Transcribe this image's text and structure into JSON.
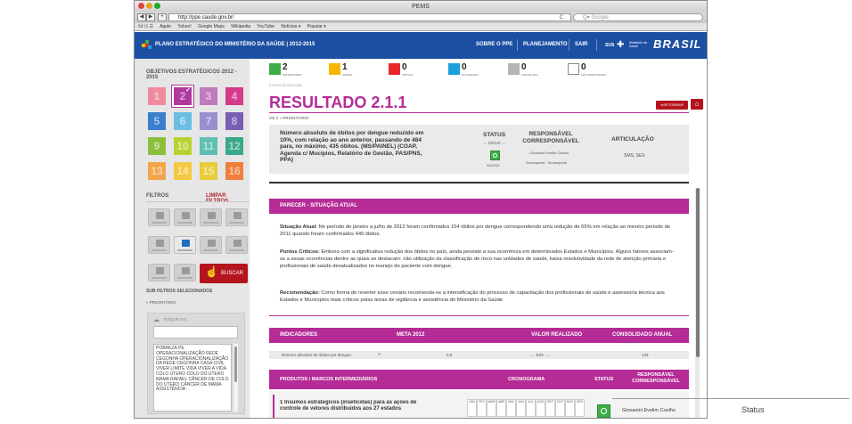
{
  "window": {
    "title": "PEMS"
  },
  "toolbar": {
    "back": "◀",
    "forward": "▶",
    "add": "+",
    "url": "http://ppe.saude.gov.br/",
    "reload": "C",
    "search_placeholder": "Q▾ Google"
  },
  "bookmarks": [
    "Apple",
    "Yahoo!",
    "Google Maps",
    "Wikipedia",
    "YouTube",
    "Notícias ▾",
    "Popular ▾"
  ],
  "header": {
    "title": "PLANO ESTRATÉGICO DO MINISTÉRIO DA SAÚDE | 2012-2015",
    "nav": [
      "SOBRE O PPE",
      "PLANEJAMENTO",
      "SAIR"
    ],
    "sus": "SUS",
    "ministerio": "Ministério da Saúde",
    "brasil": "BRASIL"
  },
  "sidebar": {
    "objectives_title": "OBJETIVOS ESTRATÉGICOS 2012 - 2015",
    "tiles": [
      {
        "n": "1",
        "color": "#f08aa0"
      },
      {
        "n": "2",
        "color": "#b03a9c"
      },
      {
        "n": "3",
        "color": "#c07ac0"
      },
      {
        "n": "4",
        "color": "#d63a8a"
      },
      {
        "n": "5",
        "color": "#3a7fcc"
      },
      {
        "n": "6",
        "color": "#6bbfe2"
      },
      {
        "n": "7",
        "color": "#9b8ecf"
      },
      {
        "n": "8",
        "color": "#7a5db5"
      },
      {
        "n": "9",
        "color": "#8dbf3d"
      },
      {
        "n": "10",
        "color": "#b8d232"
      },
      {
        "n": "11",
        "color": "#5fbfb0"
      },
      {
        "n": "12",
        "color": "#3aa88c"
      },
      {
        "n": "13",
        "color": "#f2a54a"
      },
      {
        "n": "14",
        "color": "#f5c842"
      },
      {
        "n": "15",
        "color": "#e8cc3c"
      },
      {
        "n": "16",
        "color": "#f07f3c"
      }
    ],
    "filters_title": "FILTROS",
    "clear_filters": "LIMPAR FILTROS",
    "search_button": "BUSCAR",
    "subfilters_title": "SUB FILTROS SELECIONADOS",
    "subfilter_item": "» PRIORITÁRIO",
    "tags_title": "ETIQUETAS",
    "tags_text": "POBREZA PE OPERACIONALIZAÇÃO REDE CEGONHA OPERACIONALIZAÇÃO DA REDE CEGONHA CASA CIVIL VIVER LIMITE VIDA VIVER A VIDA COLO ÚTERO COLO DO ÚTERO MAMA RAFAEL CÂNCER DE COLO DO ÚTERO CÂNCER DE MAMA ASSISTÊNCIA"
  },
  "legend": [
    {
      "count": "2",
      "label": "SATISFATÓRIO",
      "color": "#3fae49"
    },
    {
      "count": "1",
      "label": "ALERTA",
      "color": "#f5b700"
    },
    {
      "count": "0",
      "label": "CRÍTICO",
      "color": "#e5262b"
    },
    {
      "count": "0",
      "label": "ALCANÇADO",
      "color": "#1ba0dc"
    },
    {
      "count": "0",
      "label": "CANCELADO",
      "color": "#b5b5b5"
    },
    {
      "count": "0",
      "label": "NÃO MONITORADO",
      "color": "#ffffff"
    }
  ],
  "result": {
    "status_label": "STATUS DE SOLUÇÃO",
    "title": "RESULTADO 2.1.1",
    "back_button": "◂ RETORNAR",
    "home_icon": "home-icon",
    "breadcrumb": "OE 2 » PRIORITÁRIO",
    "description": "Número absoluto de óbitos por dengue reduzido em 10%, com relação ao ano anterior, passando de 484 para, no máximo, 435 óbitos. (MS/PAINEL) (COAP, Agenda c/ Mucípios, Relatório de Gestão, PAS/PNS, PPA)",
    "status_header": "STATUS",
    "ciclo": "← CICLO →",
    "status_date": "05/2012",
    "responsavel_header": "RESPONSÁVEL CORRESPONSÁVEL",
    "responsavel": "- Giovanini Evelim Coelho",
    "corresponsavel": "Scorespinet - Scorespontr",
    "articulacao_header": "ARTICULAÇÃO",
    "articulacao": "SMS, SES"
  },
  "parecer": {
    "header": "PARECER - SITUAÇÃO ATUAL",
    "situacao_label": "Situação Atual:",
    "situacao": "No período de janeiro a julho de 2012 foram confirmados 154 óbitos por dengue correspondendo uma redução de 65% em relação ao mesmo período de 2011 quando foram confirmados 445 óbitos.",
    "pontos_label": "Pontos Críticos:",
    "pontos": "Embora com a significativa redução dos óbitos no país, ainda persiste a sua ocorrência em determinados Estados e Municípios. Alguns fatores associam-se a essas ocorrências dentre as quais se destacam: não utilização da classificação de risco nas unidades de saúde, baixa resolutividade da rede de atenção primária e profissionais de saúde desatualizados no manejo do paciente com dengue.",
    "recomendacao_label": "Recomendação:",
    "recomendacao": "Como forma de reverter esse cenário recomenda-se a intensificação do processo de capacitação dos profissionais de saúde e assessoria técnica aos Estados e Munícipios mais críticos pelas áreas de vigilância e assistência do Ministério da Saúde"
  },
  "indicadores": {
    "headers": [
      "INDICADORES",
      "META 2012",
      "VALOR REALIZADO",
      "CONSOLIDADO ANUAL"
    ],
    "row": {
      "name": "Número absoluto de óbitos por dengue.",
      "meta": "0,0",
      "realizado": "← JUN- →",
      "consolidado": "133"
    }
  },
  "produtos": {
    "headers": [
      "PRODUTOS / MARCOS INTERMEDIÁRIOS",
      "CRONOGRAMA",
      "STATUS",
      "RESPONSÁVEL CORRESPONSÁVEL"
    ],
    "months": [
      "JAN",
      "FEV",
      "MAR",
      "ABR",
      "MAI",
      "JUN",
      "JUL",
      "AGO",
      "SET",
      "OUT",
      "NOV",
      "DEZ"
    ],
    "item": "1  Insumos estrategicos (inseticidas) para as ações de controle de vetores distribuidos aos 27 estados",
    "responsavel": "Giovanini Evelim Coelho"
  },
  "callout": {
    "label": "Status"
  }
}
